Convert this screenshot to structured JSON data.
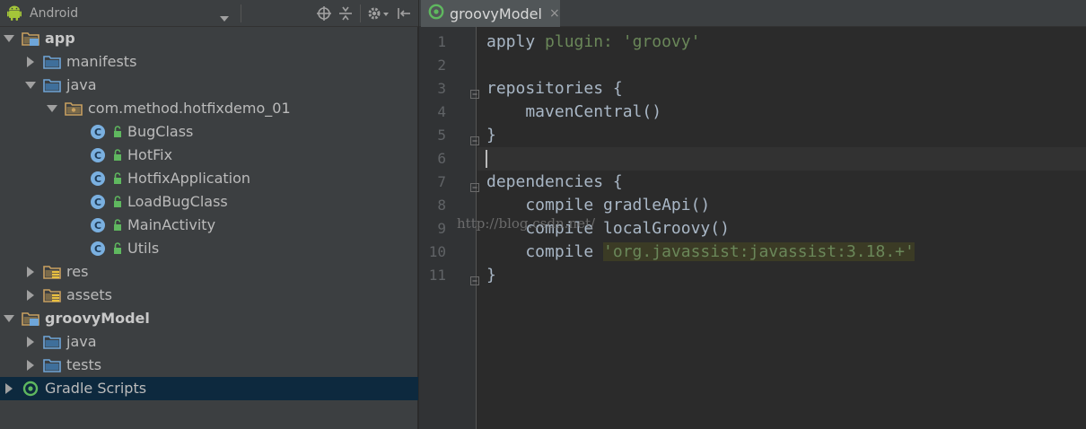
{
  "project_panel": {
    "view_selector": {
      "label": "Android"
    },
    "tree": [
      {
        "label": "app",
        "bold": true,
        "expanded": true,
        "icon": "module-folder-icon",
        "depth": 0
      },
      {
        "label": "manifests",
        "bold": false,
        "expanded": false,
        "icon": "folder-icon",
        "depth": 1
      },
      {
        "label": "java",
        "bold": false,
        "expanded": true,
        "icon": "folder-icon",
        "depth": 1
      },
      {
        "label": "com.method.hotfixdemo_01",
        "bold": false,
        "expanded": true,
        "icon": "package-icon",
        "depth": 2
      },
      {
        "label": "BugClass",
        "icon": "class-icon",
        "depth": 3
      },
      {
        "label": "HotFix",
        "icon": "class-icon",
        "depth": 3
      },
      {
        "label": "HotfixApplication",
        "icon": "class-icon",
        "depth": 3
      },
      {
        "label": "LoadBugClass",
        "icon": "class-icon",
        "depth": 3
      },
      {
        "label": "MainActivity",
        "icon": "class-icon",
        "depth": 3
      },
      {
        "label": "Utils",
        "icon": "class-icon",
        "depth": 3
      },
      {
        "label": "res",
        "bold": false,
        "expanded": false,
        "icon": "resource-folder-icon",
        "depth": 1
      },
      {
        "label": "assets",
        "bold": false,
        "expanded": false,
        "icon": "resource-folder-icon",
        "depth": 1
      },
      {
        "label": "groovyModel",
        "bold": true,
        "expanded": true,
        "icon": "module-folder-icon",
        "depth": 0
      },
      {
        "label": "java",
        "bold": false,
        "expanded": false,
        "icon": "folder-icon",
        "depth": 1
      },
      {
        "label": "tests",
        "bold": false,
        "expanded": false,
        "icon": "folder-icon",
        "depth": 1
      },
      {
        "label": "Gradle Scripts",
        "bold": false,
        "expanded": false,
        "icon": "gradle-icon",
        "depth": 0,
        "selected": true
      }
    ]
  },
  "editor": {
    "tab": {
      "label": "groovyModel",
      "close": "×"
    },
    "line_numbers": [
      "1",
      "2",
      "3",
      "4",
      "5",
      "6",
      "7",
      "8",
      "9",
      "10",
      "11"
    ],
    "lines": [
      {
        "num": "1",
        "parts": [
          [
            "apply ",
            "kw"
          ],
          [
            "plugin: ",
            "str"
          ],
          [
            "'groovy'",
            "str"
          ]
        ]
      },
      {
        "num": "2",
        "parts": []
      },
      {
        "num": "3",
        "parts": [
          [
            "repositories {",
            "kw"
          ]
        ]
      },
      {
        "num": "4",
        "parts": [
          [
            "    mavenCentral()",
            "kw"
          ]
        ]
      },
      {
        "num": "5",
        "parts": [
          [
            "}",
            "kw"
          ]
        ]
      },
      {
        "num": "6",
        "parts": []
      },
      {
        "num": "7",
        "parts": [
          [
            "dependencies {",
            "kw"
          ]
        ]
      },
      {
        "num": "8",
        "parts": [
          [
            "    compile gradleApi()",
            "kw"
          ]
        ]
      },
      {
        "num": "9",
        "parts": [
          [
            "    compile localGroovy()",
            "kw"
          ]
        ]
      },
      {
        "num": "10",
        "parts": [
          [
            "    compile ",
            "kw"
          ],
          [
            "'org.javassist:javassist:3.18.+'",
            "str-hl"
          ]
        ]
      },
      {
        "num": "11",
        "parts": [
          [
            "}",
            "kw"
          ]
        ]
      }
    ],
    "watermark": "http://blog.csdn.net/"
  },
  "colors": {
    "panel_bg": "#3c3f41",
    "editor_bg": "#2b2b2b",
    "selection": "#0d293e",
    "string": "#6a8759",
    "text": "#a9b7c6"
  }
}
